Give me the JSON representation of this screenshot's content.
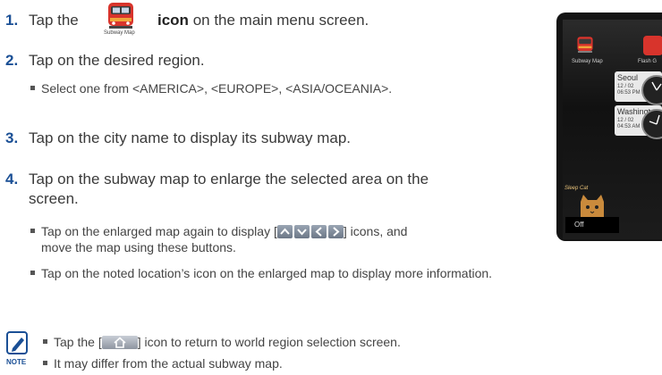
{
  "steps": [
    {
      "num": "1.",
      "pre": "Tap the",
      "bold": "icon",
      "post": "on the main menu screen."
    },
    {
      "num": "2.",
      "text": "Tap on the desired region."
    },
    {
      "num": "3.",
      "text": "Tap on the city name to display its subway map."
    },
    {
      "num": "4.",
      "line1": "Tap on the subway map to enlarge the selected area on the",
      "line2": "screen."
    }
  ],
  "subway_icon_caption": "Subway Map",
  "bullets": {
    "region": "Select one from <AMERICA>, <EUROPE>, <ASIA/OCEANIA>.",
    "enlarged_pre": "Tap on the enlarged map again to display [",
    "enlarged_post": "] icons, and",
    "enlarged_line2": "move the map using these buttons.",
    "noted": "Tap on the noted location’s icon  on the enlarged map to display more information."
  },
  "arrow_icons": [
    "arrow-up-icon",
    "arrow-down-icon",
    "arrow-left-icon",
    "arrow-right-icon"
  ],
  "note": {
    "label": "NOTE",
    "line1_pre": "Tap the [",
    "line1_post": "] icon to return to world region selection screen.",
    "line2": "It may differ from the actual subway map."
  },
  "phone": {
    "app1": "Subway Map",
    "app2": "Flash G",
    "clocks": [
      {
        "city": "Seoul",
        "date": "12 / 02",
        "time": "06:53 PM"
      },
      {
        "city": "Washingt",
        "date": "12 / 02",
        "time": "04:53 AM"
      }
    ],
    "widget": "Sleep Cat",
    "off": "Off"
  },
  "colors": {
    "step_number": "#1a4f95",
    "text": "#3a3a3a"
  }
}
